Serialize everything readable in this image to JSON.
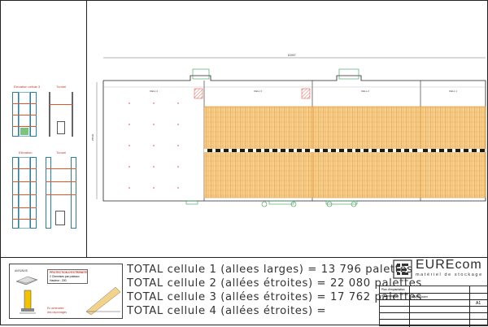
{
  "plan": {
    "overall_dimension": "81907",
    "side_dimension": "25530",
    "cells": [
      "CELL 4",
      "CELL 3",
      "CELL 2",
      "CELL 1"
    ]
  },
  "elevations": {
    "elevation_cellule_3": "Elevation cellule 3",
    "tunnel_top": "Tunnel",
    "elevation": "Elévation",
    "tunnel_bottom": "Tunnel"
  },
  "legend": {
    "title": "AVIS/AVIS",
    "protection_title": "PROTECTION D'EXTREMITÉ",
    "protection_line1": "2 Chemises par poteaux",
    "protection_line2": "Hauteur : 200",
    "note_line1": "En achevalée",
    "note_line2": "des rayonnages"
  },
  "totals": [
    "TOTAL cellule 1 (allees larges) = 13 796 palettes",
    "TOTAL cellule 2 (allées étroites) = 22 080 palettes",
    "TOTAL cellule 3 (allées étroites) = 17 762 palettes",
    "TOTAL cellule 4 (allées étroites) ="
  ],
  "logo": {
    "brand": "EUREcom",
    "tagline": "matériel de stockage"
  },
  "title_block": {
    "line1": "Plan d'implantation",
    "line2": "Rayonnages",
    "company": "EUREcom",
    "revision": "A1"
  },
  "colors": {
    "rack_fill": "#f3c37a",
    "rack_stroke": "#d98d2a",
    "beam": "#1a1a1a",
    "frame": "#2a7f9b",
    "hatch": "#d94a3a",
    "accent": "#e0562a"
  }
}
